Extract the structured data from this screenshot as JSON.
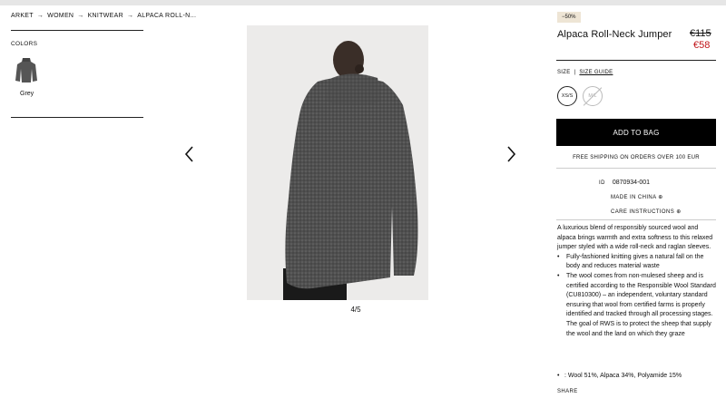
{
  "breadcrumb": [
    "ARKET",
    "WOMEN",
    "KNITWEAR",
    "ALPACA ROLL-N..."
  ],
  "colors": {
    "label": "COLORS",
    "swatch_name": "Grey"
  },
  "gallery": {
    "counter": "4/5"
  },
  "product": {
    "badge": "−50%",
    "title": "Alpaca Roll-Neck Jumper",
    "old_price": "€115",
    "new_price": "€58",
    "price_color": "#c0151a"
  },
  "size": {
    "label": "SIZE",
    "guide": "SIZE GUIDE",
    "options": [
      "XS/S",
      "M/L"
    ]
  },
  "add_to_bag": "ADD TO BAG",
  "shipping": "FREE SHIPPING ON ORDERS OVER 100 EUR",
  "meta": {
    "id_label": "ID",
    "id_value": "0870934-001",
    "made_in": "MADE IN CHINA",
    "care": "CARE INSTRUCTIONS"
  },
  "description": {
    "intro": "A luxurious blend of responsibly sourced wool and alpaca brings warmth and extra softness to this relaxed jumper styled with a wide roll-neck and raglan sleeves.",
    "bullets": [
      "Fully-fashioned knitting gives a natural fall on the body and reduces material waste",
      "The wool comes from non-mulesed sheep and is certified according to the Responsible Wool Standard (CU810300) – an independent, voluntary standard ensuring that wool from certified farms is properly identified and tracked through all processing stages. The goal of RWS is to protect the sheep that supply the wool and the land on which they graze"
    ],
    "composition": ": Wool 51%, Alpaca 34%, Polyamide 15%"
  },
  "share": "SHARE"
}
